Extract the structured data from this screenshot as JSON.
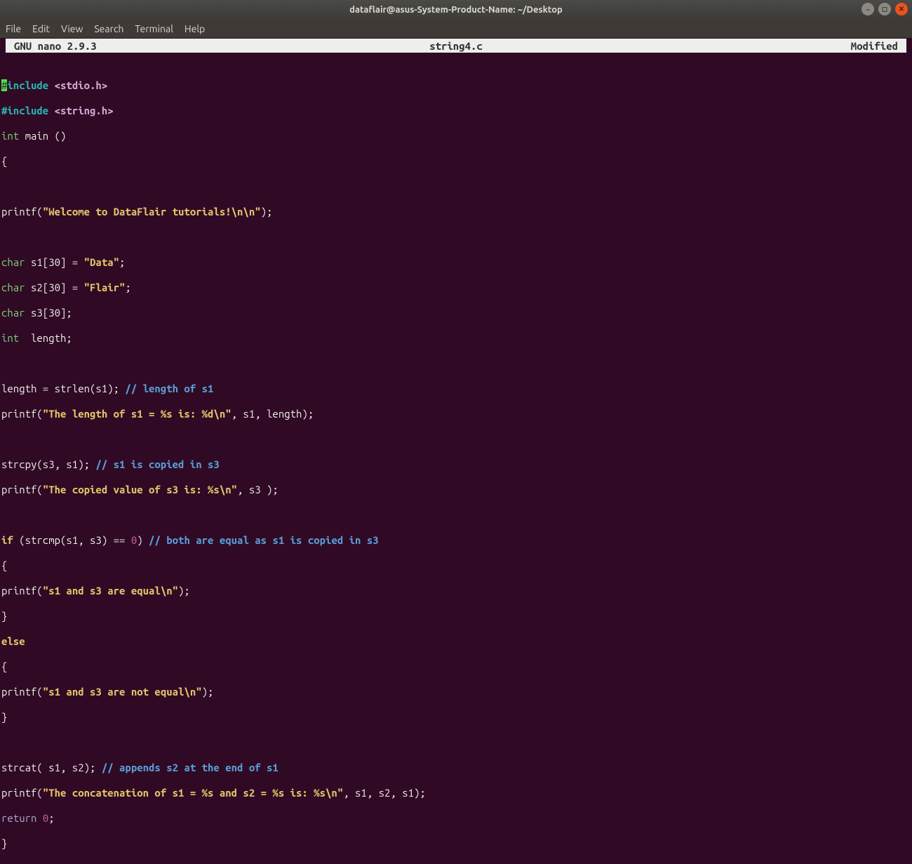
{
  "window": {
    "title": "dataflair@asus-System-Product-Name: ~/Desktop"
  },
  "menu": {
    "file": "File",
    "edit": "Edit",
    "view": "View",
    "search": "Search",
    "terminal": "Terminal",
    "help": "Help"
  },
  "nano": {
    "version": "  GNU nano 2.9.3",
    "filename": "string4.c",
    "modified": "Modified"
  },
  "code": {
    "l1a": "#",
    "l1b": "include",
    "l1c": " <stdio.h>",
    "l2a": "#include",
    "l2b": " <string.h>",
    "l3a": "int",
    "l3b": " main ()",
    "l4": "{",
    "l5": "",
    "l6a": "printf(",
    "l6b": "\"Welcome to DataFlair tutorials!\\n\\n\"",
    "l6c": ");",
    "l7": "",
    "l8a": "char",
    "l8b": " s1[30] = ",
    "l8c": "\"Data\"",
    "l8d": ";",
    "l9a": "char",
    "l9b": " s2[30] = ",
    "l9c": "\"Flair\"",
    "l9d": ";",
    "l10a": "char",
    "l10b": " s3[30];",
    "l11a": "int",
    "l11b": "  length;",
    "l12": "",
    "l13a": "length = strlen(s1); ",
    "l13b": "// length of s1",
    "l14a": "printf(",
    "l14b": "\"The length of s1 = %s is: %d\\n\"",
    "l14c": ", s1, length);",
    "l15": "",
    "l16a": "strcpy(s3, s1); ",
    "l16b": "// s1 is copied in s3",
    "l17a": "printf(",
    "l17b": "\"The copied value of s3 is: %s\\n\"",
    "l17c": ", s3 );",
    "l18": "",
    "l19a": "if",
    "l19b": " (strcmp(s1, s3) == ",
    "l19n": "0",
    "l19c": ") ",
    "l19d": "// both are equal as s1 is copied in s3",
    "l20": "{",
    "l21a": "printf(",
    "l21b": "\"s1 and s3 are equal\\n\"",
    "l21c": ");",
    "l22": "}",
    "l23": "else",
    "l24": "{",
    "l25a": "printf(",
    "l25b": "\"s1 and s3 are not equal\\n\"",
    "l25c": ");",
    "l26": "}",
    "l27": "",
    "l28a": "strcat( s1, s2); ",
    "l28b": "// appends s2 at the end of s1",
    "l29a": "printf(",
    "l29b": "\"The concatenation of s1 = %s and s2 = %s is: %s\\n\"",
    "l29c": ", s1, s2, s1);",
    "l30a": "return",
    "l30b": " ",
    "l30n": "0",
    "l30c": ";",
    "l31": "}"
  }
}
